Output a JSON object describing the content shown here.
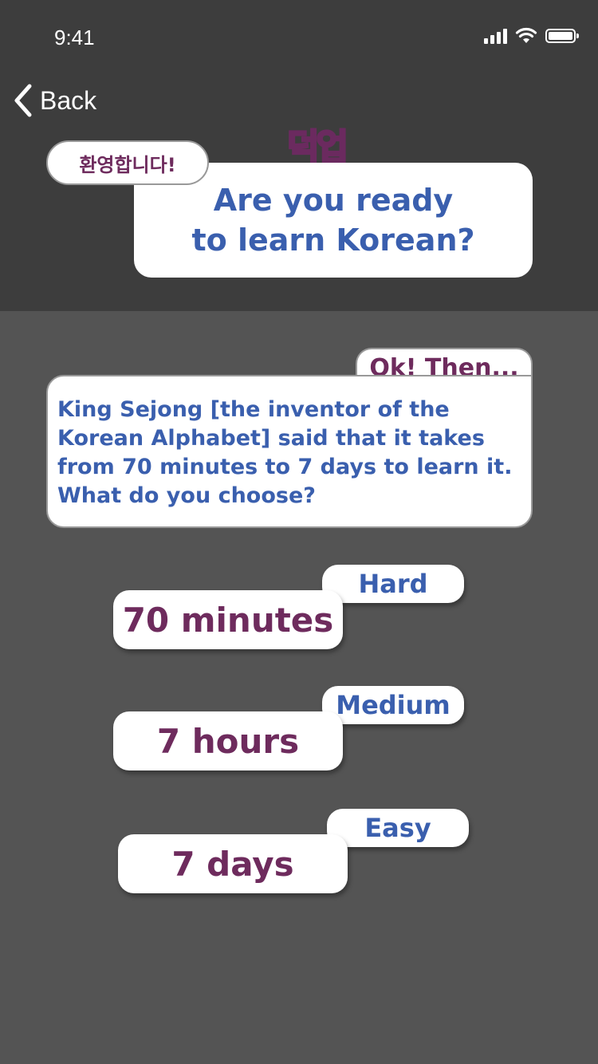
{
  "status_bar": {
    "time": "9:41",
    "icons": [
      "cellular-signal-icon",
      "wifi-icon",
      "battery-icon"
    ]
  },
  "nav": {
    "back_label": "Back",
    "back_icon": "chevron-left-icon"
  },
  "header": {
    "logo_text": "덕업",
    "welcome_text": "환영합니다!",
    "title_line1": "Are you ready",
    "title_line2": "to learn Korean?"
  },
  "prompt": {
    "tab_text": "Ok! Then...",
    "question": "King Sejong [the inventor of the Korean Alphabet] said that it takes from 70 minutes to 7 days to learn it. What do you choose?"
  },
  "options": [
    {
      "difficulty": "Hard",
      "duration": "70 minutes"
    },
    {
      "difficulty": "Medium",
      "duration": "7 hours"
    },
    {
      "difficulty": "Easy",
      "duration": "7 days"
    }
  ],
  "colors": {
    "header_bg": "#3d3d3d",
    "body_bg": "#545454",
    "blue_text": "#3a5fae",
    "purple_text": "#6e2b5d"
  }
}
